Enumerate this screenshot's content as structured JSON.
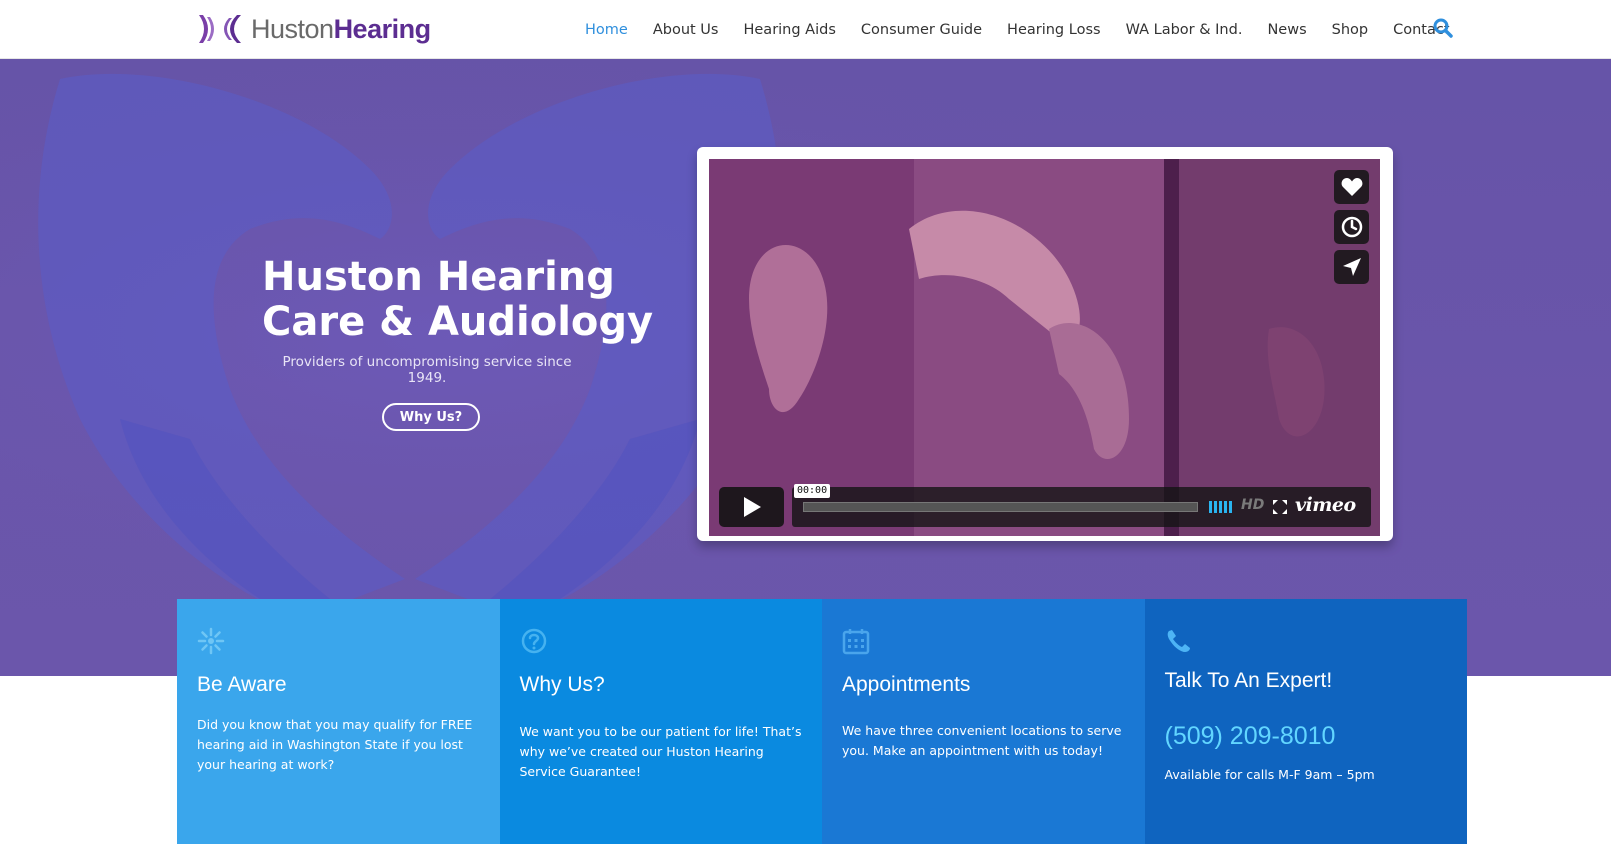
{
  "brand": {
    "logo_light": "Huston",
    "logo_bold": "Hearing",
    "accent_purple": "#5c2d91",
    "accent_blue": "#2f8fdd"
  },
  "nav": {
    "items": [
      {
        "label": "Home",
        "active": true
      },
      {
        "label": "About Us"
      },
      {
        "label": "Hearing Aids"
      },
      {
        "label": "Consumer Guide"
      },
      {
        "label": "Hearing Loss"
      },
      {
        "label": "WA Labor & Ind."
      },
      {
        "label": "News"
      },
      {
        "label": "Shop"
      },
      {
        "label": "Contact"
      }
    ],
    "search_icon": "search-icon"
  },
  "hero": {
    "title_line1": "Huston Hearing",
    "title_line2": "Care & Audiology",
    "subtitle": "Providers of uncompromising service since 1949.",
    "cta_label": "Why Us?",
    "background_color": "#6a55aa"
  },
  "video": {
    "time": "00:00",
    "progress": 0,
    "quality": "HD",
    "player_brand": "vimeo",
    "side_buttons": [
      "heart-icon",
      "clock-icon",
      "send-icon"
    ]
  },
  "features": [
    {
      "icon": "sparkle-icon",
      "title": "Be Aware",
      "text": "Did you know that you may qualify for FREE hearing aid in Washington State if you lost your hearing at work?",
      "color": "#3aa6ec"
    },
    {
      "icon": "question-icon",
      "title": "Why Us?",
      "text": "We want you to be our patient for life!  That’s why we’ve created our Huston Hearing Service Guarantee!",
      "color": "#0a8ae0"
    },
    {
      "icon": "calendar-icon",
      "title": "Appointments",
      "text": "We have three convenient locations to serve you.  Make an appointment with us today!",
      "color": "#1a78d4"
    },
    {
      "icon": "phone-icon",
      "title": "Talk To An Expert!",
      "phone": "(509) 209-8010",
      "text": "Available for calls M-F 9am – 5pm",
      "color": "#0f64bf"
    }
  ]
}
